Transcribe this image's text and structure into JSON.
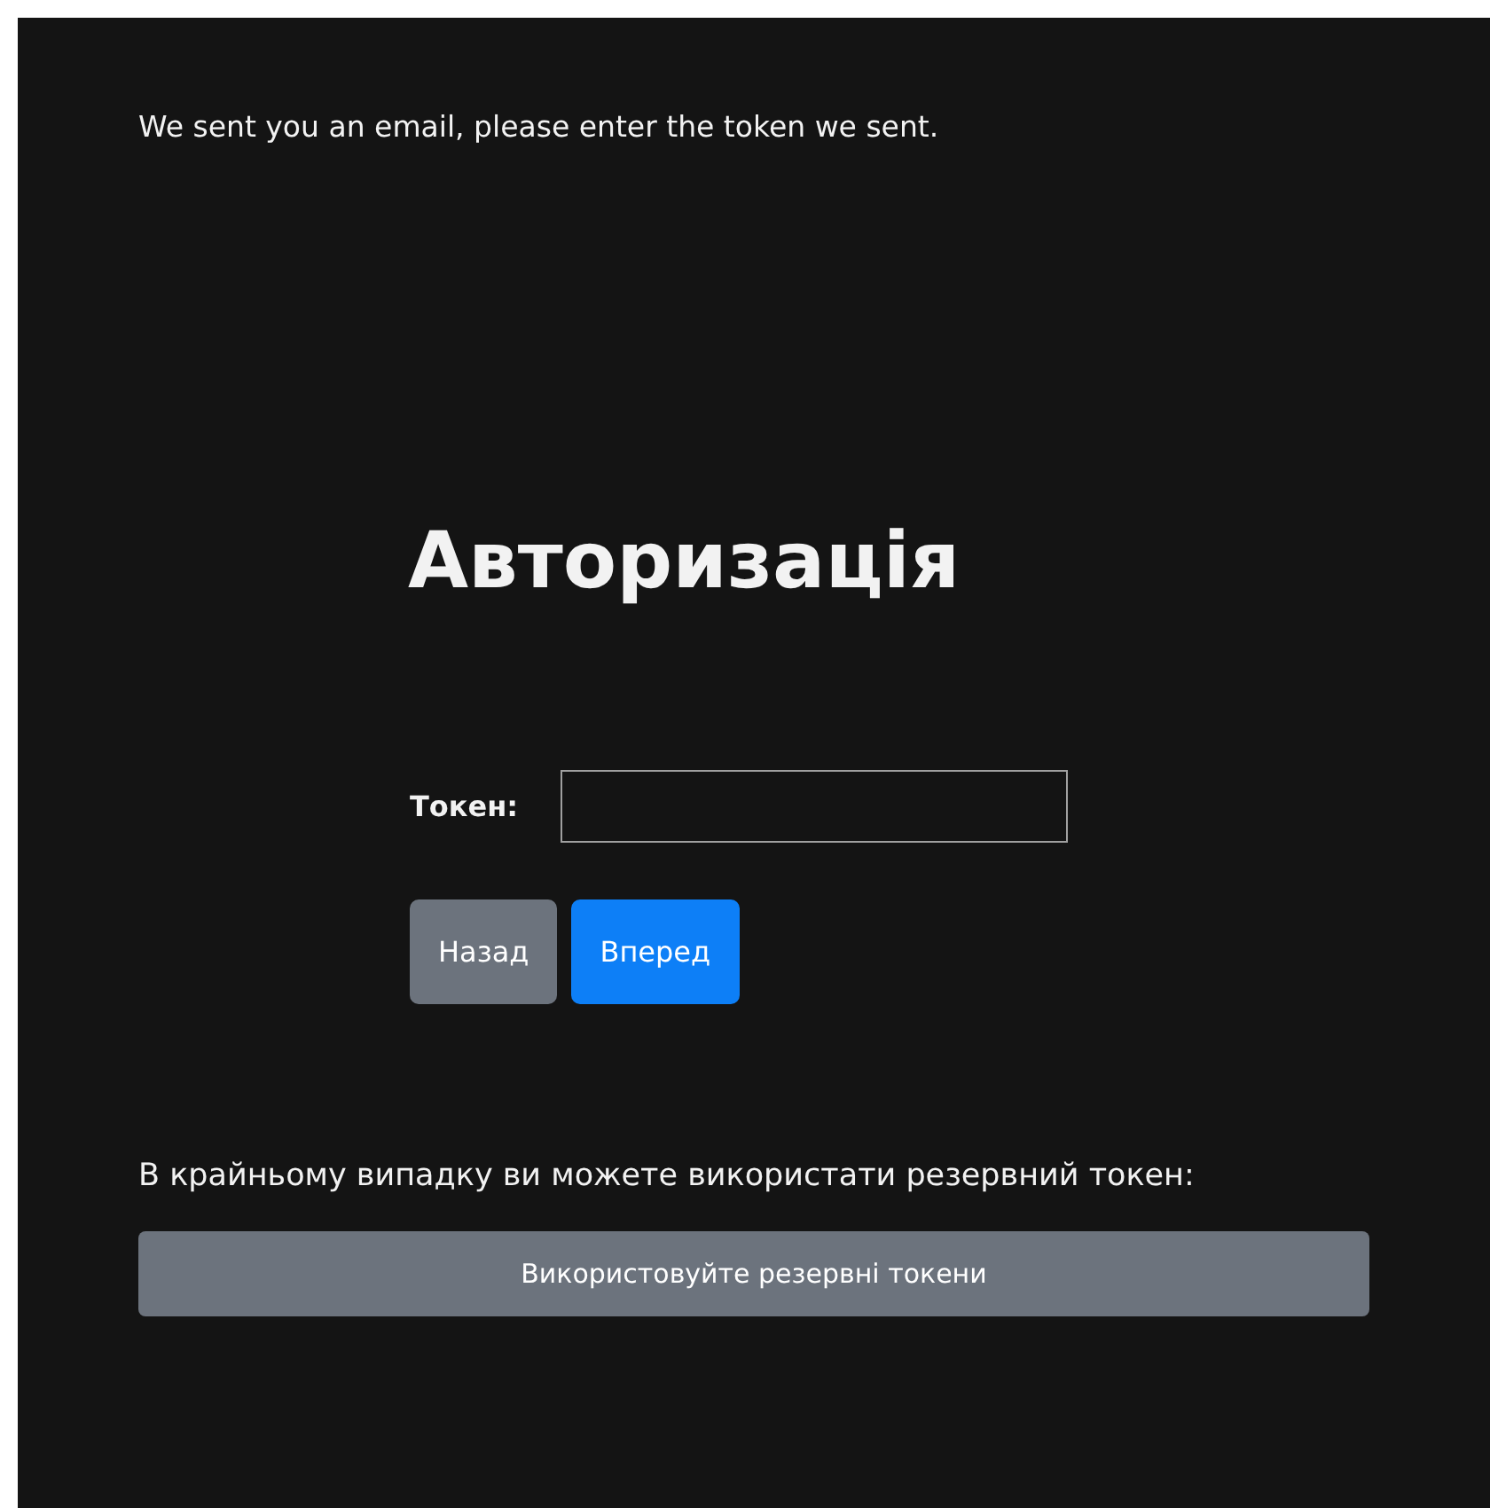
{
  "notice": "We sent you an email, please enter the token we sent.",
  "heading": "Авторизація",
  "token_field": {
    "label": "Токен:"
  },
  "buttons": [
    {
      "label": "Назад",
      "kind": "secondary"
    },
    {
      "label": "Вперед",
      "kind": "primary"
    }
  ],
  "backup": {
    "text": "В крайньому випадку ви можете використати резервний токен:",
    "button": "Використовуйте резервні токени"
  }
}
